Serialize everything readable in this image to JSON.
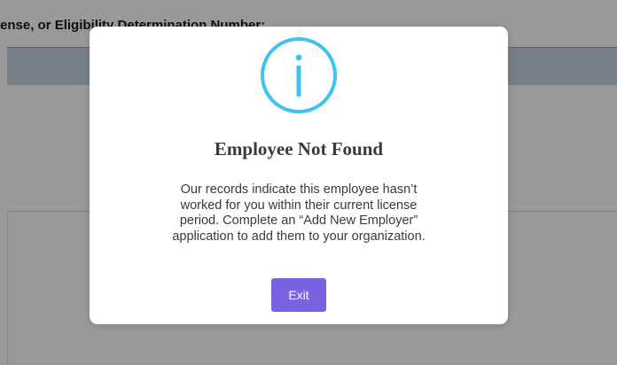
{
  "background": {
    "heading_label": "ense, or Eligibility Determination Number:"
  },
  "modal": {
    "icon": "info-icon",
    "title": "Employee Not Found",
    "message_lines": [
      "Our records indicate this employee hasn’t",
      "worked for you within their current license",
      "period. Complete an “Add New Employer”",
      "application to add them to your organization."
    ],
    "exit_label": "Exit"
  },
  "colors": {
    "accent_button": "#7b62e0",
    "icon_color": "#3fc3ee",
    "overlay": "rgba(0,0,0,0.40)",
    "header_bar": "#c9d3e4"
  }
}
